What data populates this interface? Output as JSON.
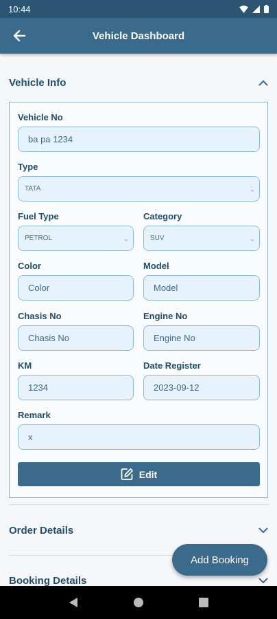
{
  "status_bar": {
    "time": "10:44"
  },
  "app_bar": {
    "title": "Vehicle Dashboard"
  },
  "sections": {
    "vehicle_info": "Vehicle Info",
    "order_details": "Order Details",
    "booking_details": "Booking Details"
  },
  "form": {
    "vehicle_no": {
      "label": "Vehicle No",
      "value": "ba pa 1234"
    },
    "type": {
      "label": "Type",
      "value": "TATA"
    },
    "fuel_type": {
      "label": "Fuel Type",
      "value": "PETROL"
    },
    "category": {
      "label": "Category",
      "value": "SUV"
    },
    "color": {
      "label": "Color",
      "value": "Color"
    },
    "model": {
      "label": "Model",
      "value": "Model"
    },
    "chasis_no": {
      "label": "Chasis No",
      "value": "Chasis No"
    },
    "engine_no": {
      "label": "Engine No",
      "value": "Engine No"
    },
    "km": {
      "label": "KM",
      "value": "1234"
    },
    "date_register": {
      "label": "Date Register",
      "value": "2023-09-12"
    },
    "remark": {
      "label": "Remark",
      "value": "x"
    }
  },
  "buttons": {
    "edit": "Edit",
    "add_booking": "Add Booking"
  },
  "icons": {
    "back": "arrow-left-icon",
    "collapse": "chevron-up-icon",
    "expand": "chevron-down-icon",
    "edit": "edit-icon",
    "wifi": "wifi-icon",
    "signal": "signal-icon",
    "battery": "battery-icon"
  },
  "colors": {
    "primary": "#3a6a8c",
    "field_bg": "#e6f3fd",
    "field_border": "#8cb8dc",
    "heading": "#1f4d6e"
  }
}
